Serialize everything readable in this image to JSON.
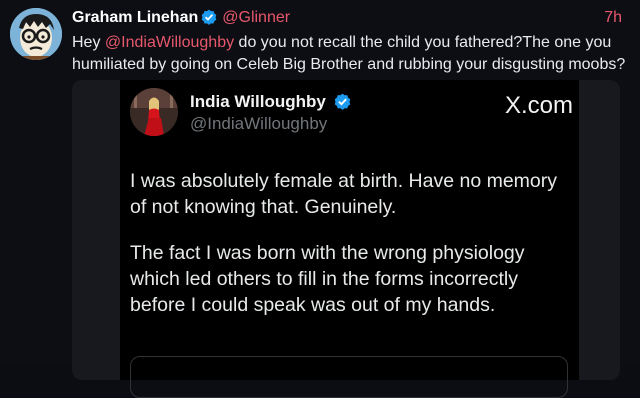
{
  "post": {
    "author_name": "Graham Linehan",
    "handle": "@Glinner",
    "time": "7h",
    "text_prefix": "Hey ",
    "mention": "@IndiaWilloughby",
    "text_rest": " do you not recall the child you fathered?The one you humiliated by going on Celeb Big Brother and rubbing your disgusting moobs?",
    "accent_color": "#e8586c"
  },
  "embed": {
    "author_name": "India Willoughby",
    "handle": "@IndiaWilloughby",
    "site_label": "X.com",
    "paragraphs": [
      "I was absolutely female at birth. Have no memory of not knowing that. Genuinely.",
      "The fact I was born with the wrong physiology which led others to fill in the forms incorrectly before I could speak was out of my hands."
    ],
    "verified_color": "#1d9bf0"
  }
}
